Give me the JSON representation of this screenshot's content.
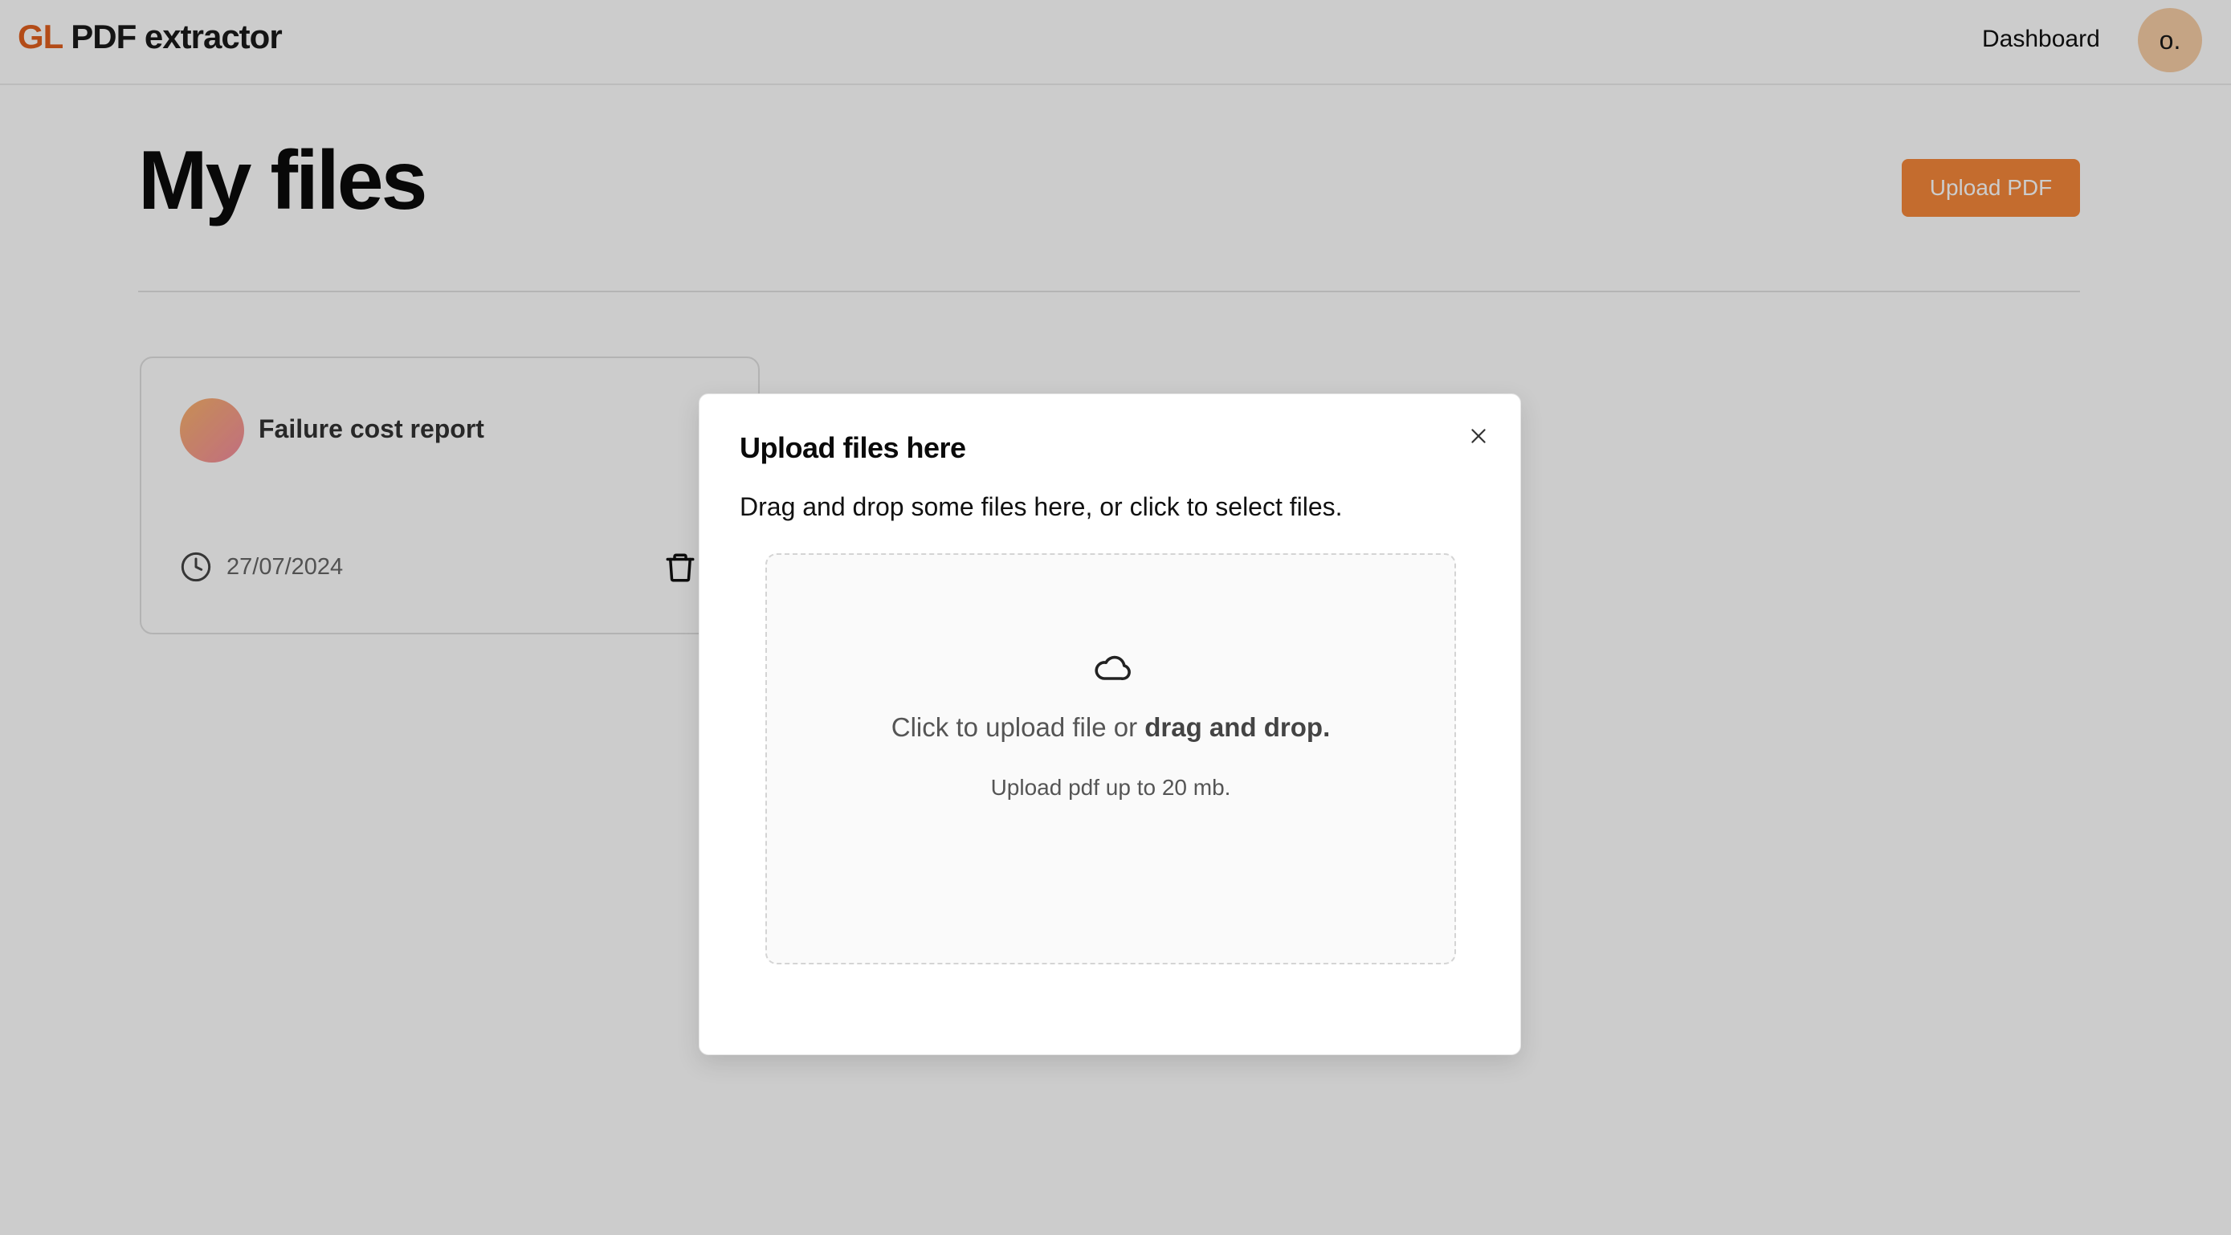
{
  "header": {
    "logo_prefix": "GL",
    "logo_rest": "PDF extractor",
    "nav_dashboard": "Dashboard",
    "avatar_initial": "o."
  },
  "main": {
    "title": "My files",
    "upload_button": "Upload PDF"
  },
  "files": [
    {
      "name": "Failure cost report",
      "date": "27/07/2024"
    }
  ],
  "modal": {
    "title": "Upload files here",
    "description": "Drag and drop some files here, or click to select files.",
    "dropzone_text_plain": "Click to upload file or ",
    "dropzone_text_bold": "drag and drop.",
    "dropzone_hint": "Upload pdf up to 20 mb."
  },
  "icons": {
    "close": "close-icon",
    "cloud": "cloud-icon",
    "clock": "clock-icon",
    "trash": "trash-icon"
  },
  "colors": {
    "accent": "#e0601e",
    "button": "#f5883a",
    "avatar": "#f7cea6",
    "overlay": "rgba(0,0,0,0.2)"
  }
}
